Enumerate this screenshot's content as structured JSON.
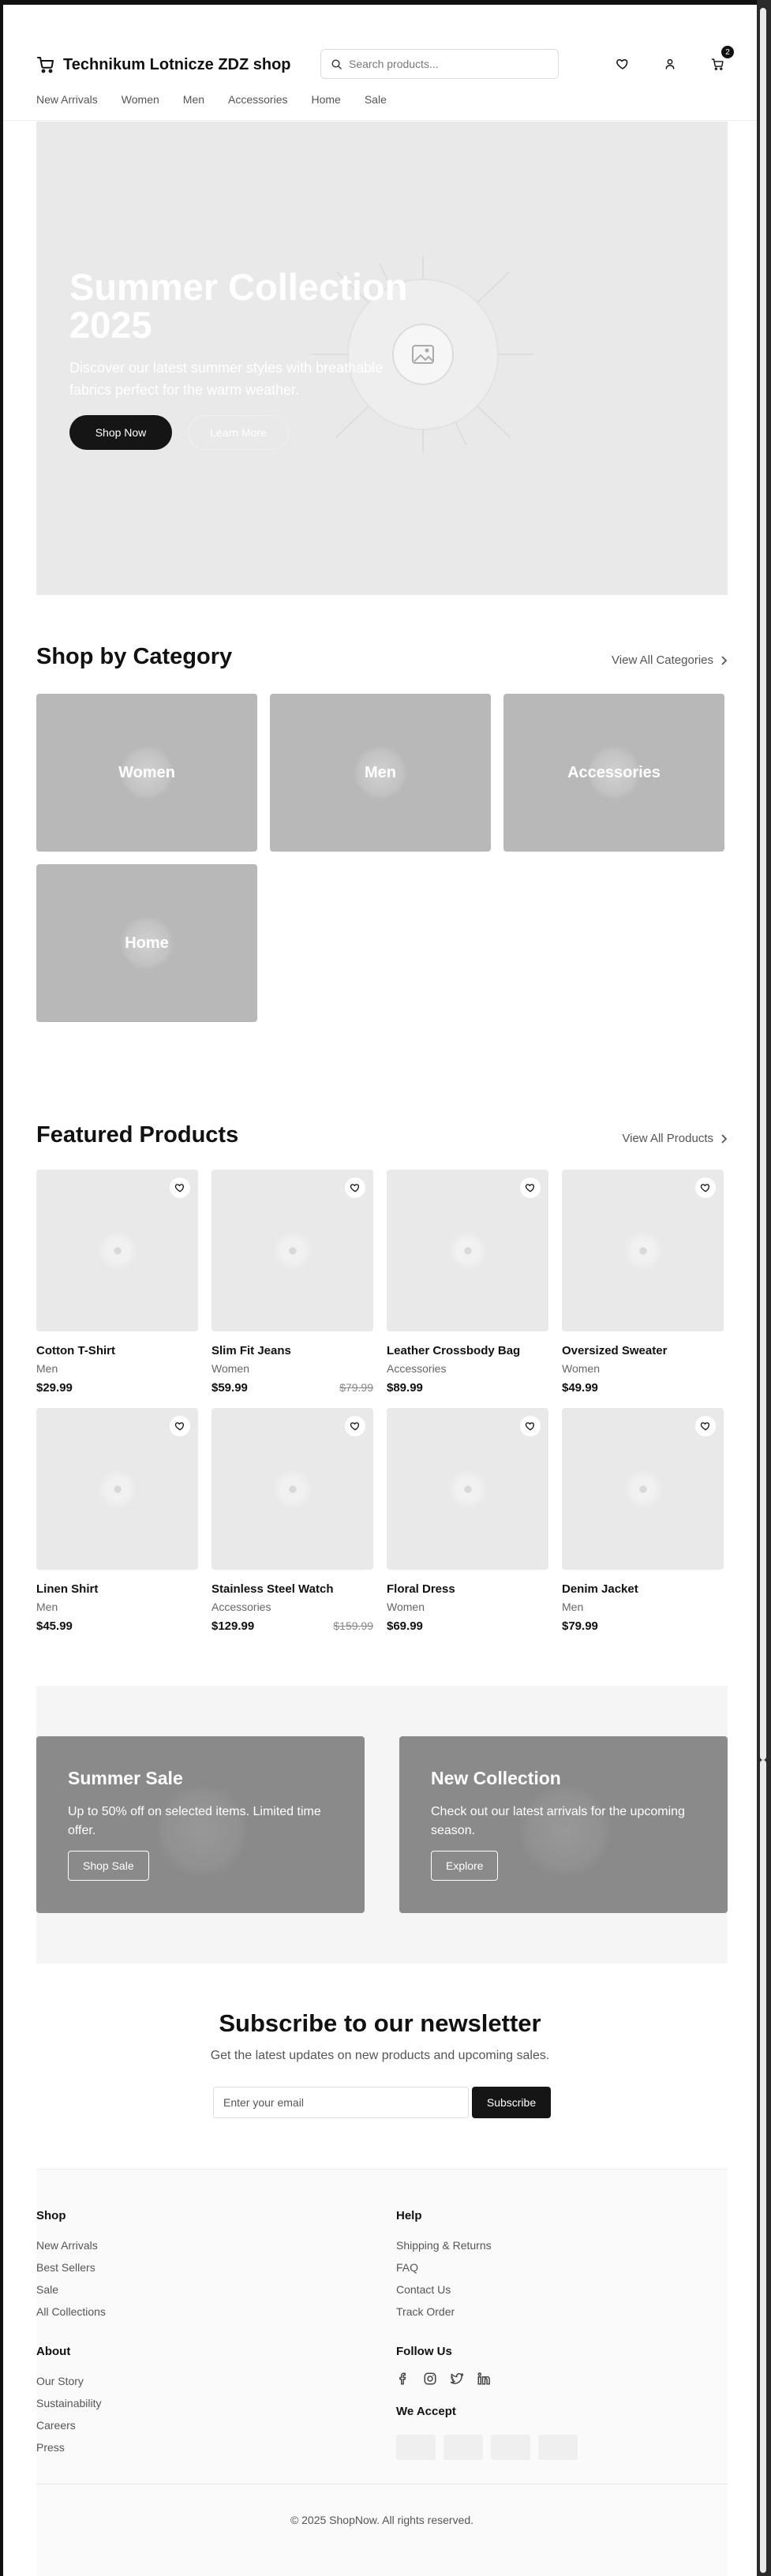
{
  "header": {
    "shop_name": "Technikum Lotnicze ZDZ shop",
    "search_placeholder": "Search products...",
    "cart_count": "2"
  },
  "nav": [
    "New Arrivals",
    "Women",
    "Men",
    "Accessories",
    "Home",
    "Sale"
  ],
  "hero": {
    "title": "Summer Collection 2025",
    "subtitle": "Discover our latest summer styles with breathable fabrics perfect for the warm weather.",
    "primary_button": "Shop Now",
    "secondary_button": "Learn More"
  },
  "categories": {
    "title": "Shop by Category",
    "link": "View All Categories",
    "items": [
      "Women",
      "Men",
      "Accessories",
      "Home"
    ]
  },
  "featured": {
    "title": "Featured Products",
    "link": "View All Products",
    "products": [
      {
        "name": "Cotton T-Shirt",
        "category": "Men",
        "price": "$29.99",
        "old_price": ""
      },
      {
        "name": "Slim Fit Jeans",
        "category": "Women",
        "price": "$59.99",
        "old_price": "$79.99"
      },
      {
        "name": "Leather Crossbody Bag",
        "category": "Accessories",
        "price": "$89.99",
        "old_price": ""
      },
      {
        "name": "Oversized Sweater",
        "category": "Women",
        "price": "$49.99",
        "old_price": ""
      },
      {
        "name": "Linen Shirt",
        "category": "Men",
        "price": "$45.99",
        "old_price": ""
      },
      {
        "name": "Stainless Steel Watch",
        "category": "Accessories",
        "price": "$129.99",
        "old_price": "$159.99"
      },
      {
        "name": "Floral Dress",
        "category": "Women",
        "price": "$69.99",
        "old_price": ""
      },
      {
        "name": "Denim Jacket",
        "category": "Men",
        "price": "$79.99",
        "old_price": ""
      }
    ]
  },
  "promos": [
    {
      "title": "Summer Sale",
      "text": "Up to 50% off on selected items. Limited time offer.",
      "button": "Shop Sale"
    },
    {
      "title": "New Collection",
      "text": "Check out our latest arrivals for the upcoming season.",
      "button": "Explore"
    }
  ],
  "newsletter": {
    "title": "Subscribe to our newsletter",
    "subtitle": "Get the latest updates on new products and upcoming sales.",
    "placeholder": "Enter your email",
    "button": "Subscribe"
  },
  "footer": {
    "shop": {
      "title": "Shop",
      "links": [
        "New Arrivals",
        "Best Sellers",
        "Sale",
        "All Collections"
      ]
    },
    "help": {
      "title": "Help",
      "links": [
        "Shipping & Returns",
        "FAQ",
        "Contact Us",
        "Track Order"
      ]
    },
    "about": {
      "title": "About",
      "links": [
        "Our Story",
        "Sustainability",
        "Careers",
        "Press"
      ]
    },
    "follow_title": "Follow Us",
    "social_icons": [
      "facebook-icon",
      "instagram-icon",
      "twitter-icon",
      "linkedin-icon"
    ],
    "payment_title": "We Accept",
    "copyright": "© 2025 ShopNow. All rights reserved."
  },
  "colors": {
    "dark": "#151515",
    "hero_bg": "#e9e9e9",
    "category_bg": "#b8b8b8",
    "promo_bg": "#8a8a8a"
  }
}
